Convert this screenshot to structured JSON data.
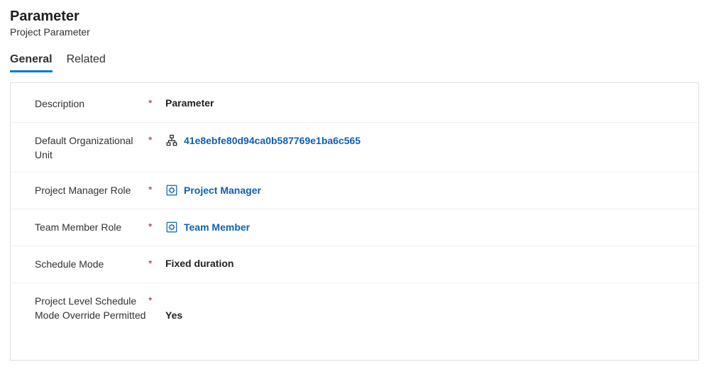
{
  "header": {
    "title": "Parameter",
    "subtitle": "Project Parameter"
  },
  "tabs": [
    {
      "label": "General",
      "active": true
    },
    {
      "label": "Related",
      "active": false
    }
  ],
  "fields": {
    "description": {
      "label": "Description",
      "required": true,
      "value": "Parameter",
      "link": false,
      "icon": null
    },
    "org_unit": {
      "label": "Default Organizational Unit",
      "required": true,
      "value": "41e8ebfe80d94ca0b587769e1ba6c565",
      "link": true,
      "icon": "org-unit"
    },
    "pm_role": {
      "label": "Project Manager Role",
      "required": true,
      "value": "Project Manager",
      "link": true,
      "icon": "role"
    },
    "team_role": {
      "label": "Team Member Role",
      "required": true,
      "value": "Team Member",
      "link": true,
      "icon": "role"
    },
    "schedule_mode": {
      "label": "Schedule Mode",
      "required": true,
      "value": "Fixed duration",
      "link": false,
      "icon": null
    },
    "override": {
      "label": "Project Level Schedule Mode Override Permitted",
      "required": true,
      "value": "Yes",
      "link": false,
      "icon": null
    }
  },
  "required_marker": "*"
}
